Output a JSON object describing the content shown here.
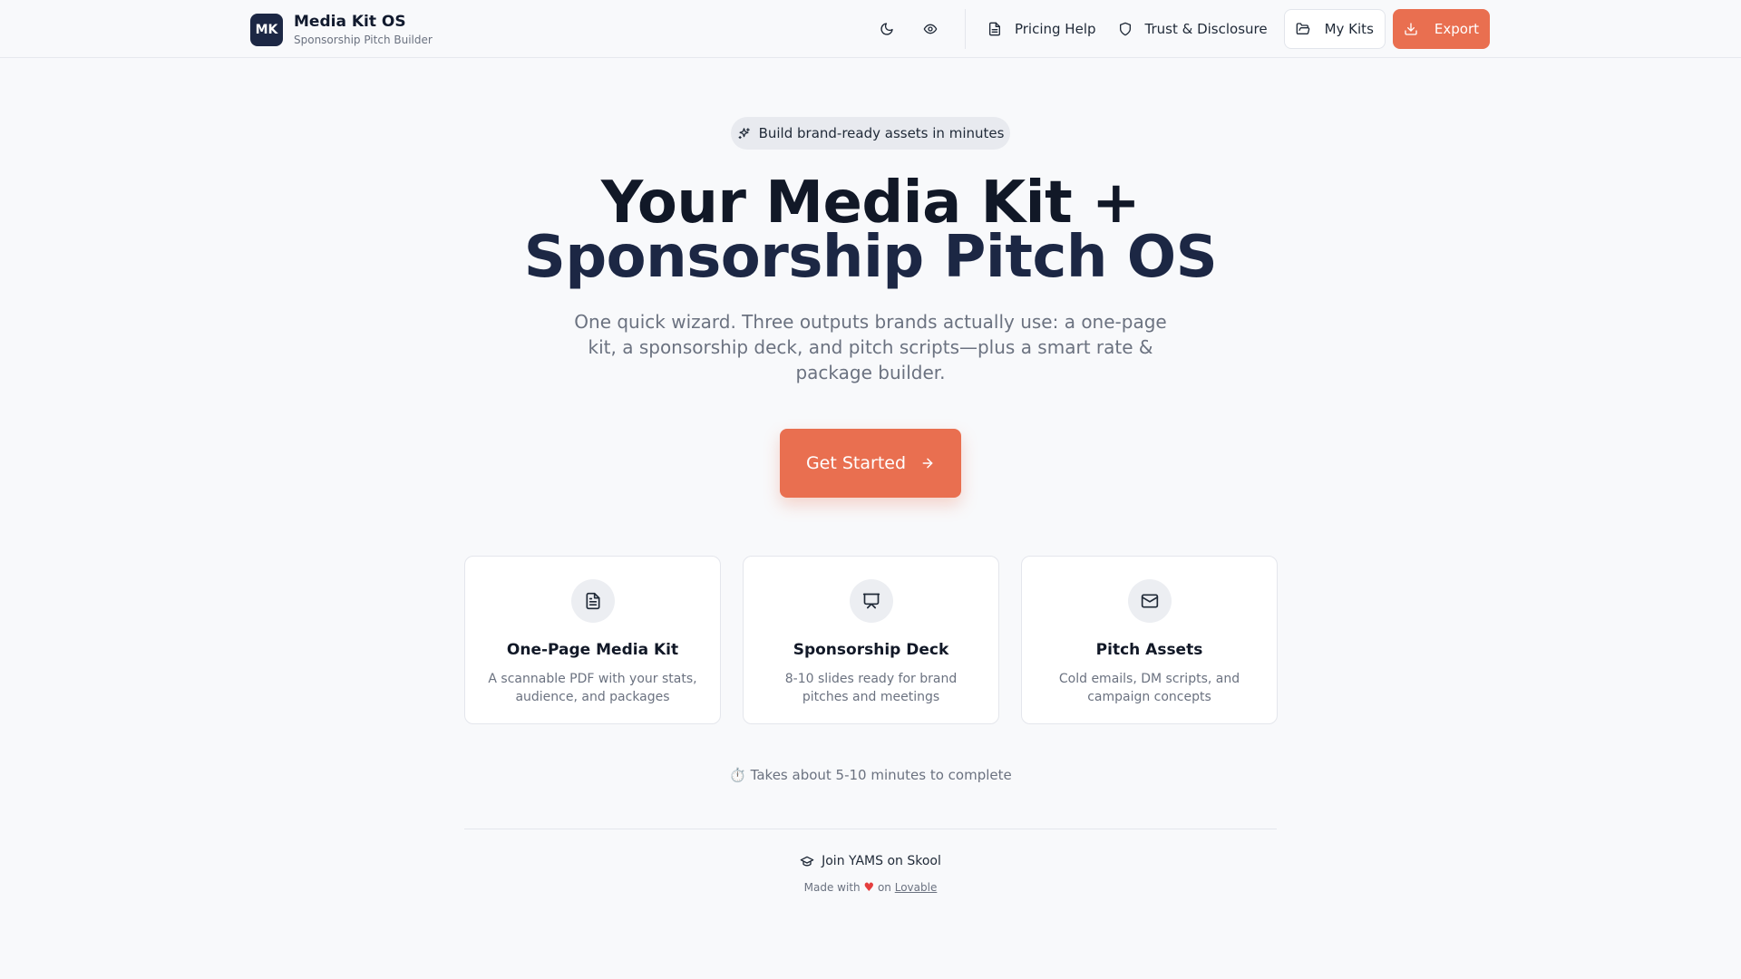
{
  "header": {
    "logo_text": "MK",
    "title": "Media Kit OS",
    "subtitle": "Sponsorship Pitch Builder",
    "theme_icon": "moon-icon",
    "preview_icon": "eye-icon",
    "nav": {
      "pricing_help": "Pricing Help",
      "trust_disclosure": "Trust & Disclosure",
      "my_kits": "My Kits",
      "export": "Export"
    }
  },
  "hero": {
    "badge": "Build brand-ready assets in minutes",
    "title_line1": "Your Media Kit +",
    "title_line2": "Sponsorship Pitch OS",
    "description": "One quick wizard. Three outputs brands actually use: a one-page kit, a sponsorship deck, and pitch scripts—plus a smart rate & package builder.",
    "cta": "Get Started"
  },
  "cards": [
    {
      "icon": "document-icon",
      "title": "One-Page Media Kit",
      "description": "A scannable PDF with your stats, audience, and packages"
    },
    {
      "icon": "presentation-icon",
      "title": "Sponsorship Deck",
      "description": "8-10 slides ready for brand pitches and meetings"
    },
    {
      "icon": "mail-icon",
      "title": "Pitch Assets",
      "description": "Cold emails, DM scripts, and campaign concepts"
    }
  ],
  "time_note": "⏱️ Takes about 5-10 minutes to complete",
  "footer": {
    "skool_link": "Join YAMS on Skool",
    "made_with": "Made with",
    "heart": "♥",
    "on": "on",
    "lovable": "Lovable"
  },
  "colors": {
    "accent": "#e96f50",
    "navy": "#1c2744",
    "background": "#f8f9fb"
  }
}
